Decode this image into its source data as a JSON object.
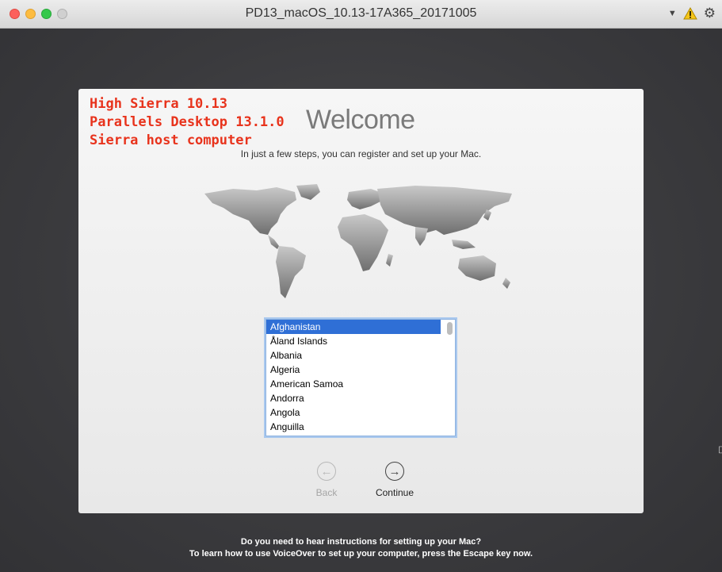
{
  "window": {
    "title": "PD13_macOS_10.13-17A365_20171005"
  },
  "toolbar": {
    "dropdown_icon": "triangle-down-icon",
    "warning_icon": "warning-icon",
    "settings_icon": "gear-icon"
  },
  "annotation": {
    "lines": [
      "High Sierra 10.13",
      "Parallels Desktop 13.1.0",
      "Sierra host computer"
    ],
    "color": "#e8331c"
  },
  "welcome": {
    "title": "Welcome",
    "subtitle": "In just a few steps, you can register and set up your Mac."
  },
  "country_list": {
    "selected": "Afghanistan",
    "items": [
      "Afghanistan",
      "Åland Islands",
      "Albania",
      "Algeria",
      "American Samoa",
      "Andorra",
      "Angola",
      "Anguilla"
    ],
    "selection_color": "#2f6fd6"
  },
  "nav": {
    "back_label": "Back",
    "continue_label": "Continue"
  },
  "voiceover": {
    "line1": "Do you need to hear instructions for setting up your Mac?",
    "line2": "To learn how to use VoiceOver to set up your computer, press the Escape key now."
  }
}
